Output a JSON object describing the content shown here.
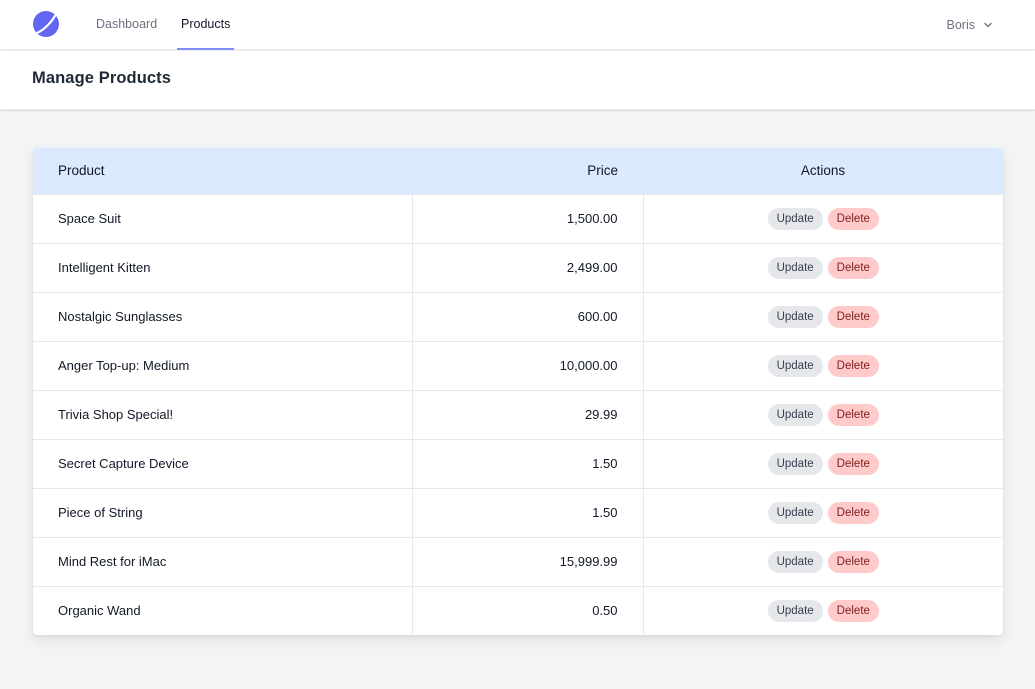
{
  "nav": {
    "links": [
      {
        "label": "Dashboard"
      },
      {
        "label": "Products"
      }
    ],
    "user": "Boris"
  },
  "page": {
    "title": "Manage Products"
  },
  "table": {
    "columns": [
      "Product",
      "Price",
      "Actions"
    ],
    "actions": {
      "update": "Update",
      "delete": "Delete"
    },
    "rows": [
      {
        "product": "Space Suit",
        "price": "1,500.00"
      },
      {
        "product": "Intelligent Kitten",
        "price": "2,499.00"
      },
      {
        "product": "Nostalgic Sunglasses",
        "price": "600.00"
      },
      {
        "product": "Anger Top-up: Medium",
        "price": "10,000.00"
      },
      {
        "product": "Trivia Shop Special!",
        "price": "29.99"
      },
      {
        "product": "Secret Capture Device",
        "price": "1.50"
      },
      {
        "product": "Piece of String",
        "price": "1.50"
      },
      {
        "product": "Mind Rest for iMac",
        "price": "15,999.99"
      },
      {
        "product": "Organic Wand",
        "price": "0.50"
      }
    ]
  },
  "colors": {
    "accent": "#818cf8",
    "logo": "#6366f1",
    "header_row": "#dbeafe",
    "delete_bg": "#fecaca",
    "update_bg": "#e5e7eb"
  }
}
